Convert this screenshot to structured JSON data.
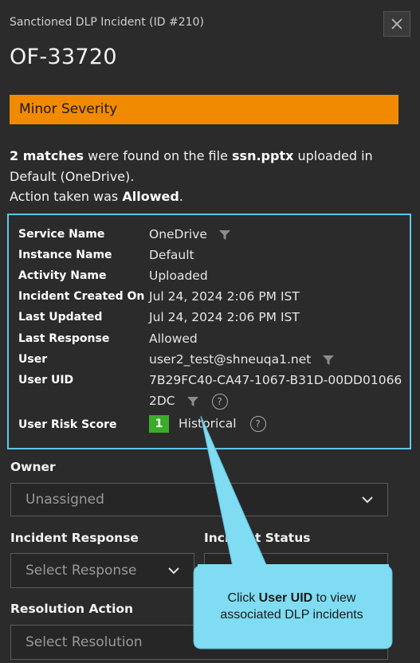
{
  "header": {
    "title": "Sanctioned DLP Incident (ID #210)",
    "close_icon": "close-icon"
  },
  "incident": {
    "id": "OF-33720"
  },
  "severity": {
    "label": "Minor Severity",
    "color": "#f28a00"
  },
  "summary": {
    "matches": "2 matches",
    "text1": " were found on the file ",
    "file": "ssn.pptx",
    "text2": " uploaded in Default (OneDrive).",
    "action_prefix": "Action taken was ",
    "action": "Allowed",
    "action_suffix": "."
  },
  "details": {
    "service_name": {
      "label": "Service Name",
      "value": "OneDrive"
    },
    "instance_name": {
      "label": "Instance Name",
      "value": "Default"
    },
    "activity_name": {
      "label": "Activity Name",
      "value": "Uploaded"
    },
    "incident_created_on": {
      "label": "Incident Created On",
      "value": "Jul 24, 2024 2:06 PM IST"
    },
    "last_updated": {
      "label": "Last Updated",
      "value": "Jul 24, 2024 2:06 PM IST"
    },
    "last_response": {
      "label": "Last Response",
      "value": "Allowed"
    },
    "user": {
      "label": "User",
      "value": "user2_test@shneuqa1.net"
    },
    "user_uid": {
      "label": "User UID",
      "value_line1": "7B29FC40-CA47-1067-B31D-00DD01066",
      "value_line2": "2DC"
    },
    "user_risk_score": {
      "label": "User Risk Score",
      "score": "1",
      "score_color": "#3bab2a",
      "level": "Historical"
    },
    "help_glyph": "?"
  },
  "form": {
    "owner": {
      "label": "Owner",
      "value": "Unassigned"
    },
    "incident_response": {
      "label": "Incident Response",
      "placeholder": "Select Response"
    },
    "incident_status": {
      "label": "Incident Status"
    },
    "resolution_action": {
      "label": "Resolution Action",
      "placeholder": "Select Resolution"
    }
  },
  "callout": {
    "prefix": "Click ",
    "bold": "User UID",
    "suffix": " to view associated DLP incidents",
    "color": "#7fdcf2"
  }
}
